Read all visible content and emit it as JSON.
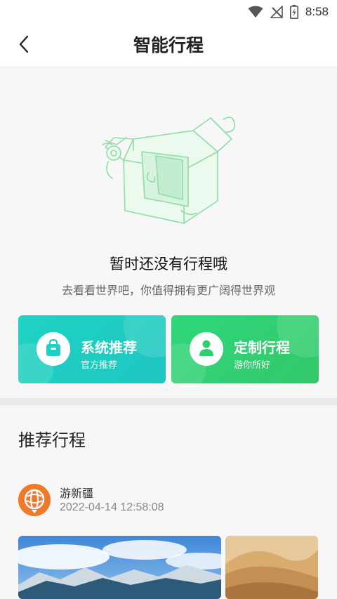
{
  "status_bar": {
    "time": "8:58",
    "icons": [
      "wifi-icon",
      "no-signal-icon",
      "battery-charging-icon"
    ]
  },
  "header": {
    "title": "智能行程",
    "back_icon": "chevron-left-icon"
  },
  "empty_state": {
    "title": "暂时还没有行程哦",
    "subtitle": "去看看世界吧，你值得拥有更广阔得世界观",
    "illustration": "empty-box-illustration",
    "accent_color": "#7fd59a"
  },
  "cards": [
    {
      "title": "系统推荐",
      "subtitle": "官方推荐",
      "icon": "bag-icon",
      "color": "#1fcfc3"
    },
    {
      "title": "定制行程",
      "subtitle": "游你所好",
      "icon": "person-icon",
      "color": "#2fcf6f"
    }
  ],
  "recommend": {
    "title": "推荐行程",
    "post": {
      "user": "游新疆",
      "time": "2022-04-14 12:58:08",
      "avatar_color": "#f07a2a",
      "photos": [
        "mountain-landscape-photo",
        "desert-dunes-photo"
      ]
    }
  }
}
